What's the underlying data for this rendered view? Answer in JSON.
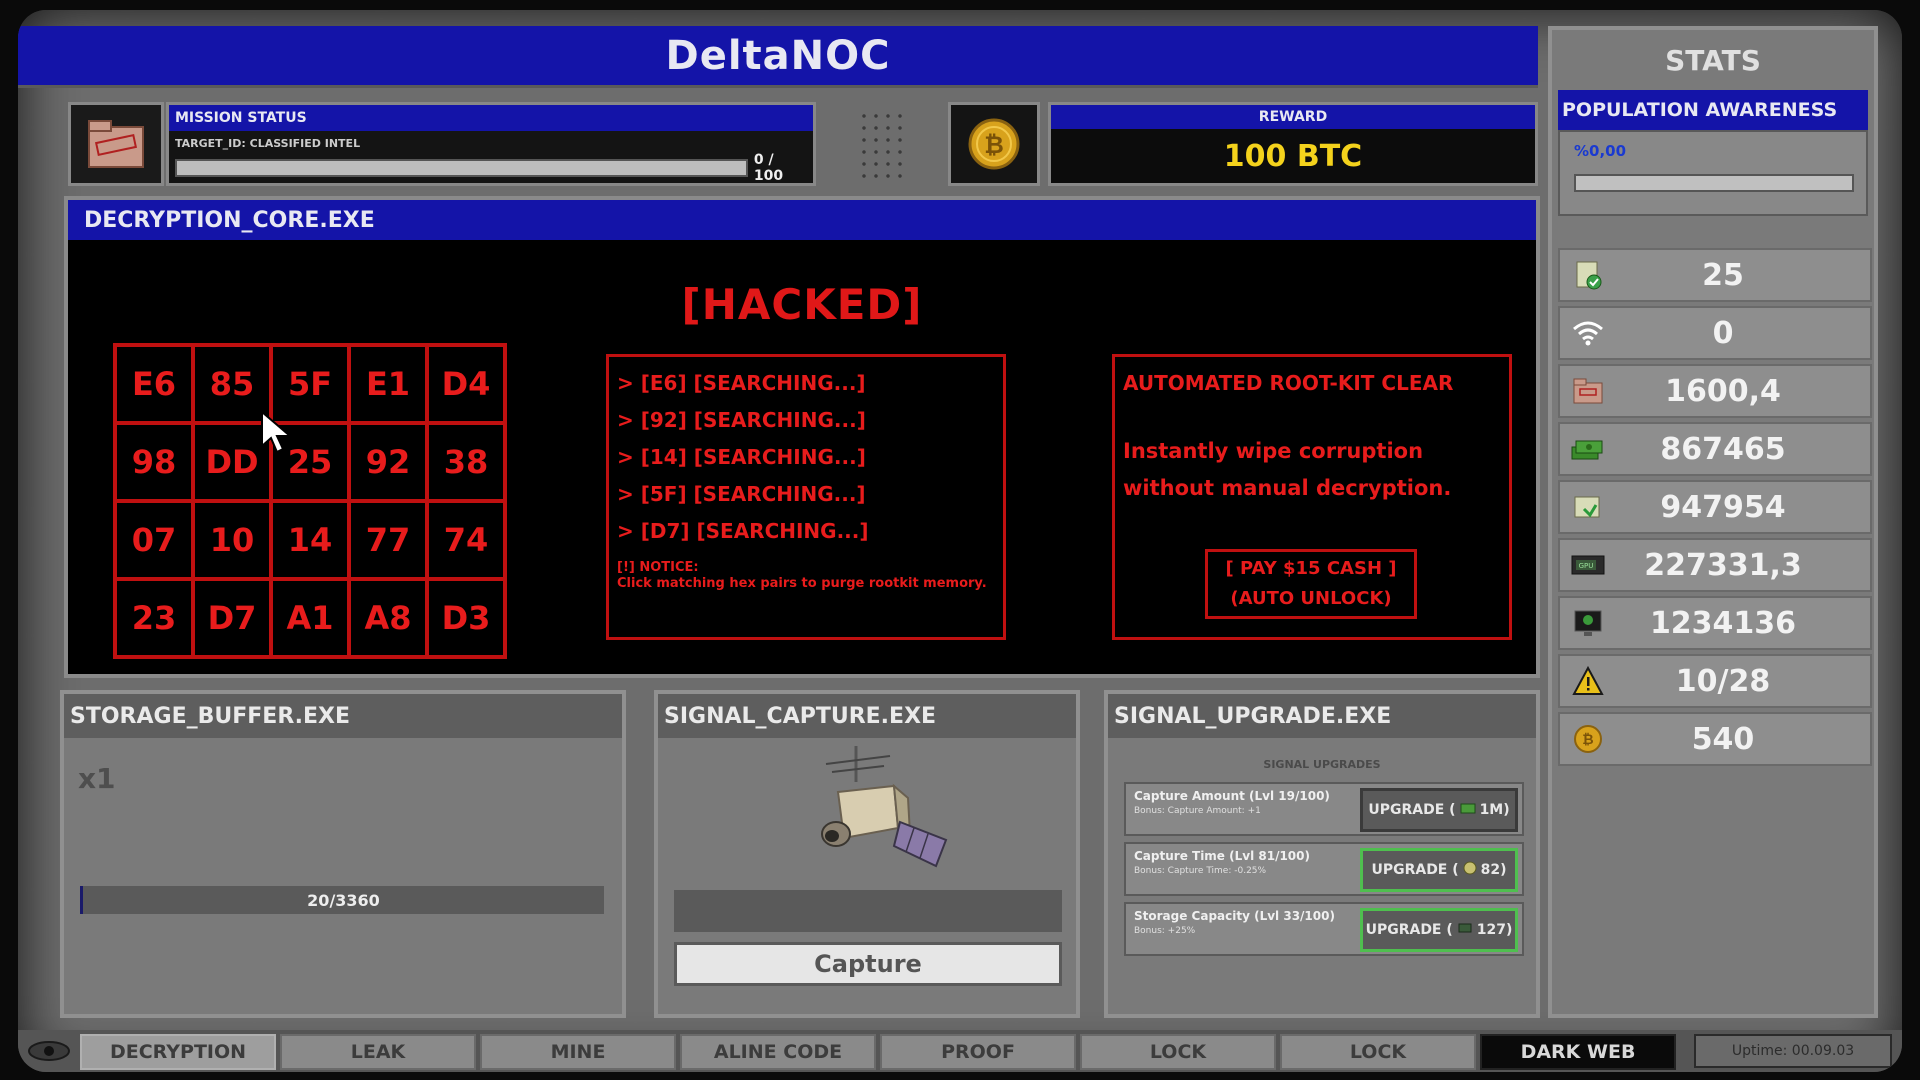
{
  "app": {
    "title": "DeltaNOC"
  },
  "mission": {
    "header": "MISSION STATUS",
    "target": "TARGET_ID: CLASSIFIED INTEL",
    "progress_text": "0 / 100",
    "progress": 0,
    "icon": "classified-folder-icon"
  },
  "reward": {
    "header": "REWARD",
    "value": "100 BTC",
    "icon": "bitcoin-icon"
  },
  "decryption": {
    "title": "DECRYPTION_CORE.EXE",
    "status": "[HACKED]",
    "grid": [
      [
        "E6",
        "85",
        "5F",
        "E1",
        "D4"
      ],
      [
        "98",
        "DD",
        "25",
        "92",
        "38"
      ],
      [
        "07",
        "10",
        "14",
        "77",
        "74"
      ],
      [
        "23",
        "D7",
        "A1",
        "A8",
        "D3"
      ]
    ],
    "search_lines": [
      "> [E6] [SEARCHING...]",
      "> [92] [SEARCHING...]",
      "> [14] [SEARCHING...]",
      "> [5F] [SEARCHING...]",
      "> [D7] [SEARCHING...]"
    ],
    "notice_title": "[!] NOTICE:",
    "notice_text": "Click matching hex pairs to purge rootkit memory.",
    "rootkit": {
      "title": "AUTOMATED ROOT-KIT CLEAR",
      "text": "Instantly wipe corruption without manual decryption.",
      "button_line1": "[ PAY $15 CASH ]",
      "button_line2": "(AUTO UNLOCK)"
    },
    "colors": {
      "accent": "#e01818",
      "header": "#1414a8"
    }
  },
  "storage": {
    "title": "STORAGE_BUFFER.EXE",
    "multiplier": "x1",
    "progress_text": "20/3360",
    "progress": 0.006
  },
  "capture": {
    "title": "SIGNAL_CAPTURE.EXE",
    "button": "Capture",
    "icon": "satellite-icon"
  },
  "upgrades": {
    "title": "SIGNAL_UPGRADE.EXE",
    "subtitle": "SIGNAL UPGRADES",
    "items": [
      {
        "name": "Capture Amount (Lvl 19/100)",
        "bonus": "Bonus: Capture Amount: +1",
        "button": "UPGRADE (",
        "cost": "1M)",
        "icon": "cash-icon"
      },
      {
        "name": "Capture Time (Lvl 81/100)",
        "bonus": "Bonus: Capture Time: -0.25%",
        "button": "UPGRADE (",
        "cost": "82)",
        "icon": "data-icon"
      },
      {
        "name": "Storage Capacity (Lvl 33/100)",
        "bonus": "Bonus: +25%",
        "button": "UPGRADE (",
        "cost": "127)",
        "icon": "chip-icon"
      }
    ]
  },
  "stats": {
    "title": "STATS",
    "population_header": "POPULATION AWARENESS",
    "population_value": "%0,00",
    "population": 0,
    "rows": [
      {
        "icon": "verified-document-icon",
        "value": "25"
      },
      {
        "icon": "wifi-icon",
        "value": "0"
      },
      {
        "icon": "classified-folder-icon",
        "value": "1600,4"
      },
      {
        "icon": "cash-stack-icon",
        "value": "867465"
      },
      {
        "icon": "data-folder-icon",
        "value": "947954"
      },
      {
        "icon": "gpu-icon",
        "value": "227331,3"
      },
      {
        "icon": "monitor-icon",
        "value": "1234136"
      },
      {
        "icon": "warning-icon",
        "value": "10/28"
      },
      {
        "icon": "bitcoin-icon",
        "value": "540"
      }
    ]
  },
  "nav": {
    "tabs": [
      "DECRYPTION",
      "LEAK",
      "MINE",
      "ALINE CODE",
      "PROOF",
      "LOCK",
      "LOCK",
      "DARK WEB"
    ],
    "active": "DECRYPTION",
    "uptime": "Uptime: 00.09.03"
  }
}
